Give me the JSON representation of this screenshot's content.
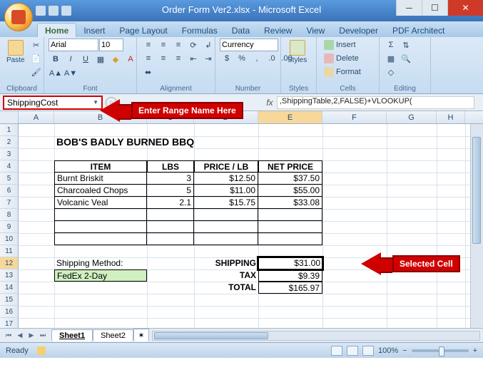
{
  "title": "Order Form Ver2.xlsx - Microsoft Excel",
  "tabs": [
    "Home",
    "Insert",
    "Page Layout",
    "Formulas",
    "Data",
    "Review",
    "View",
    "Developer",
    "PDF Architect"
  ],
  "active_tab": "Home",
  "ribbon": {
    "clipboard": {
      "paste": "Paste",
      "title": "Clipboard"
    },
    "font": {
      "name": "Arial",
      "size": "10",
      "title": "Font"
    },
    "alignment": {
      "title": "Alignment"
    },
    "number": {
      "format": "Currency",
      "title": "Number"
    },
    "styles": {
      "label": "Styles",
      "title": "Styles"
    },
    "cells": {
      "insert": "Insert",
      "delete": "Delete",
      "format": "Format",
      "title": "Cells"
    },
    "editing": {
      "title": "Editing"
    }
  },
  "name_box": "ShippingCost",
  "formula": ",ShippingTable,2,FALSE)+VLOOKUP(",
  "annotations": {
    "name_box": "Enter Range Name Here",
    "selected": "Selected Cell"
  },
  "columns": [
    {
      "l": "A",
      "w": 50
    },
    {
      "l": "B",
      "w": 130
    },
    {
      "l": "C",
      "w": 66
    },
    {
      "l": "D",
      "w": 90
    },
    {
      "l": "E",
      "w": 90
    },
    {
      "l": "F",
      "w": 90
    },
    {
      "l": "G",
      "w": 70
    },
    {
      "l": "H",
      "w": 40
    }
  ],
  "rows": 17,
  "selected_col": "E",
  "selected_row": 12,
  "sheet": {
    "title": "BOB'S BADLY BURNED BBQ",
    "headers": {
      "item": "ITEM",
      "lbs": "LBS",
      "price": "PRICE / LB",
      "net": "NET PRICE"
    },
    "items": [
      {
        "name": "Burnt Briskit",
        "lbs": "3",
        "price": "$12.50",
        "net": "$37.50"
      },
      {
        "name": "Charcoaled Chops",
        "lbs": "5",
        "price": "$11.00",
        "net": "$55.00"
      },
      {
        "name": "Volcanic Veal",
        "lbs": "2.1",
        "price": "$15.75",
        "net": "$33.08"
      }
    ],
    "ship_method_label": "Shipping Method:",
    "ship_method": "FedEx 2-Day",
    "shipping_label": "SHIPPING",
    "shipping": "$31.00",
    "tax_label": "TAX",
    "tax": "$9.39",
    "total_label": "TOTAL",
    "total": "$165.97"
  },
  "sheets": [
    "Sheet1",
    "Sheet2"
  ],
  "active_sheet": "Sheet1",
  "status": {
    "left": "Ready",
    "zoom": "100%"
  }
}
